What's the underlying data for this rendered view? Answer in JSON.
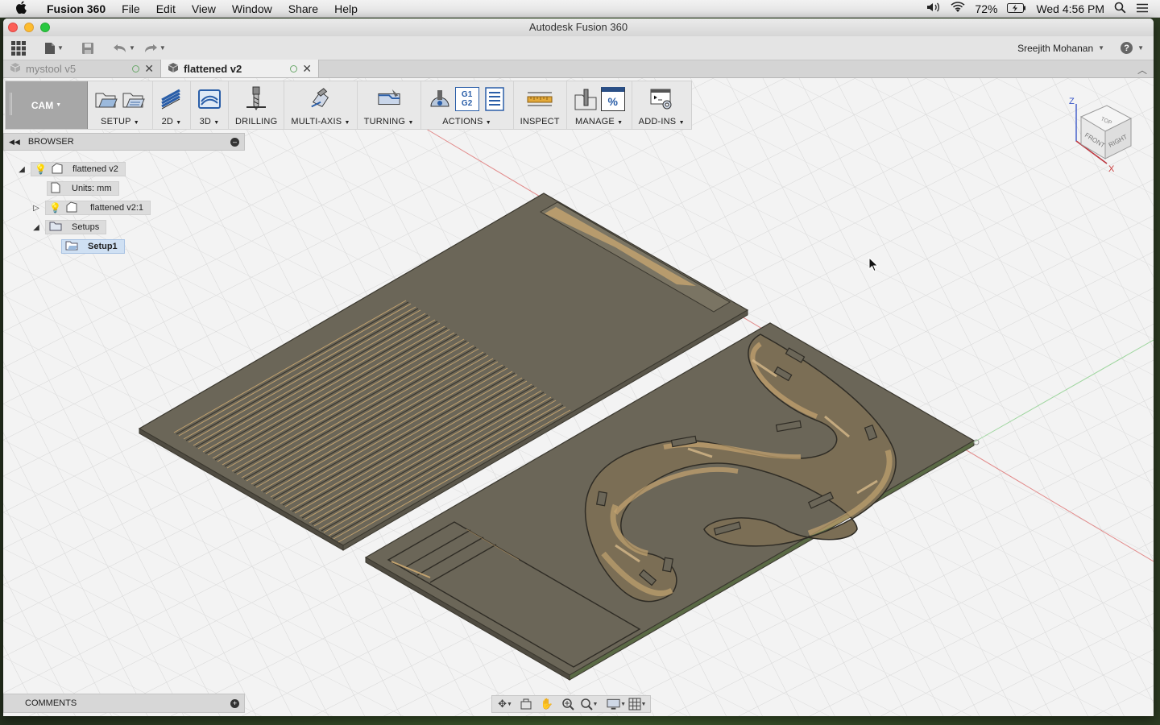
{
  "menubar": {
    "apple_icon": "apple-icon",
    "app_name": "Fusion 360",
    "items": [
      "File",
      "Edit",
      "View",
      "Window",
      "Share",
      "Help"
    ],
    "volume_icon": "volume-icon",
    "wifi_icon": "wifi-icon",
    "battery": "72%",
    "battery_icon": "battery-charging-icon",
    "clock": "Wed 4:56 PM",
    "spotlight_icon": "search-icon",
    "notifications_icon": "list-icon"
  },
  "window": {
    "title": "Autodesk Fusion 360"
  },
  "toolbar": {
    "user_name": "Sreejith Mohanan",
    "help_label": "?"
  },
  "tabs": [
    {
      "label": "mystool v5",
      "active": false
    },
    {
      "label": "flattened v2",
      "active": true
    }
  ],
  "ribbon": {
    "workspace": "CAM",
    "groups": [
      {
        "label": "SETUP",
        "dropdown": true
      },
      {
        "label": "2D",
        "dropdown": true
      },
      {
        "label": "3D",
        "dropdown": true
      },
      {
        "label": "DRILLING",
        "dropdown": false
      },
      {
        "label": "MULTI-AXIS",
        "dropdown": true
      },
      {
        "label": "TURNING",
        "dropdown": true
      },
      {
        "label": "ACTIONS",
        "dropdown": true
      },
      {
        "label": "INSPECT",
        "dropdown": false
      },
      {
        "label": "MANAGE",
        "dropdown": true
      },
      {
        "label": "ADD-INS",
        "dropdown": true
      }
    ],
    "actions_icon_text": [
      "G1",
      "G2"
    ],
    "manage_icon_text": "%"
  },
  "browser": {
    "title": "BROWSER",
    "nodes": [
      {
        "label": "flattened v2"
      },
      {
        "label": "Units: mm"
      },
      {
        "label": "flattened v2:1"
      },
      {
        "label": "Setups"
      },
      {
        "label": "Setup1"
      }
    ]
  },
  "navcube": {
    "faces": {
      "top": "TOP",
      "front": "FRONT",
      "right": "RIGHT"
    },
    "axes": {
      "z": "Z",
      "x": "X"
    }
  },
  "comments": {
    "title": "COMMENTS"
  },
  "colors": {
    "stock": "#6b6658",
    "stock_dark": "#4f4b41",
    "toolpath": "#c2a26f",
    "selection": "#cfe0f3",
    "workspace": "#a7a7a7"
  }
}
